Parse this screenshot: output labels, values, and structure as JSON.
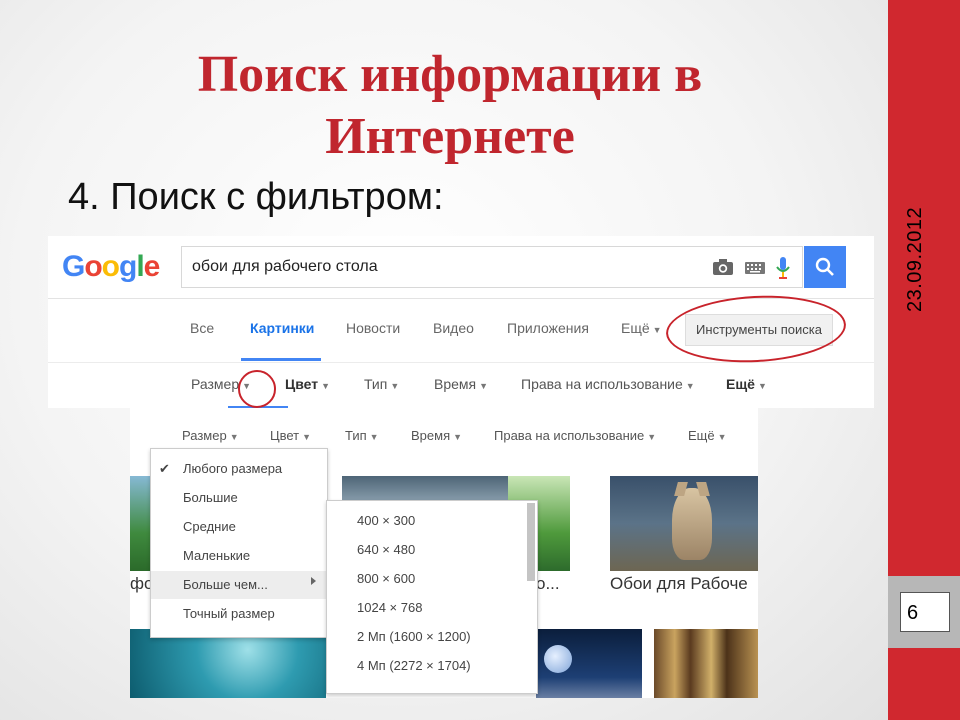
{
  "slide": {
    "title": "Поиск информации в Интернете",
    "subtitle": "4. Поиск с фильтром:",
    "date": "23.09.2012",
    "page_number": "6"
  },
  "google": {
    "logo_letters": [
      {
        "ch": "G",
        "color": "#4285f4"
      },
      {
        "ch": "o",
        "color": "#ea4335"
      },
      {
        "ch": "o",
        "color": "#fbbc05"
      },
      {
        "ch": "g",
        "color": "#4285f4"
      },
      {
        "ch": "l",
        "color": "#34a853"
      },
      {
        "ch": "e",
        "color": "#ea4335"
      }
    ],
    "query": "обои для рабочего стола",
    "tabs": [
      "Все",
      "Картинки",
      "Новости",
      "Видео",
      "Приложения",
      "Ещё"
    ],
    "active_tab": "Картинки",
    "tools_button": "Инструменты поиска",
    "filters_top": [
      "Размер",
      "Цвет",
      "Тип",
      "Время",
      "Права на использование",
      "Ещё"
    ],
    "filters_second": [
      "Размер",
      "Цвет",
      "Тип",
      "Время",
      "Права на использование",
      "Ещё"
    ],
    "size_menu": [
      "Любого размера",
      "Большие",
      "Средние",
      "Маленькие",
      "Больше чем...",
      "Точный размер"
    ],
    "size_menu_checked": "Любого размера",
    "larger_than_submenu": [
      "400 × 300",
      "640 × 480",
      "800 × 600",
      "1024 × 768",
      "2 Мп (1600 × 1200)",
      "4 Мп (2272 × 1704)"
    ],
    "image_captions": [
      "фо",
      "о...",
      "Обои для Рабоче"
    ]
  }
}
